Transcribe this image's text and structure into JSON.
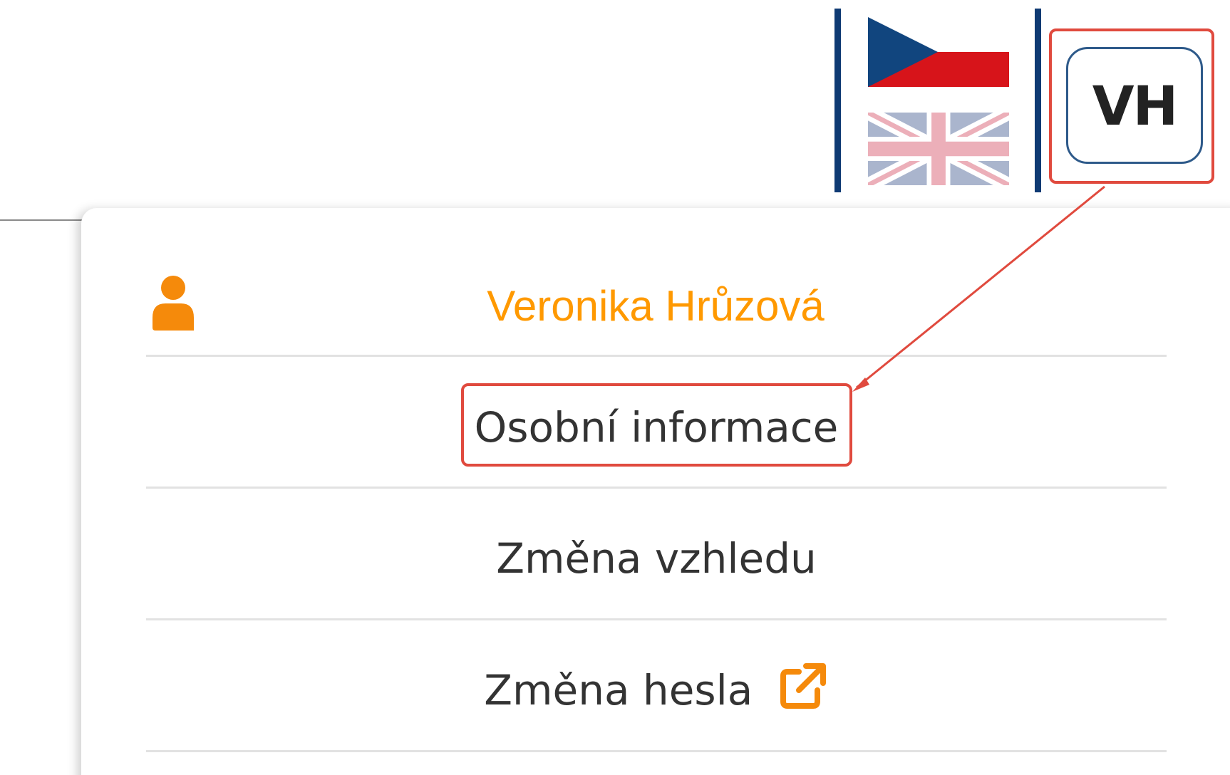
{
  "header": {
    "languages": [
      {
        "code": "cs",
        "name": "cz-flag",
        "active": true
      },
      {
        "code": "en",
        "name": "gb-flag",
        "active": false
      }
    ],
    "avatar_initials": "VH"
  },
  "user_menu": {
    "user_name": "Veronika Hrůzová",
    "items": [
      {
        "label": "Osobní informace",
        "highlighted": true
      },
      {
        "label": "Změna vzhledu"
      },
      {
        "label": "Změna hesla",
        "icon": "external-link-icon"
      }
    ]
  },
  "colors": {
    "accent": "#ff9900",
    "navy": "#0f3a73",
    "annotation": "#e04a3e",
    "text": "#333333"
  }
}
